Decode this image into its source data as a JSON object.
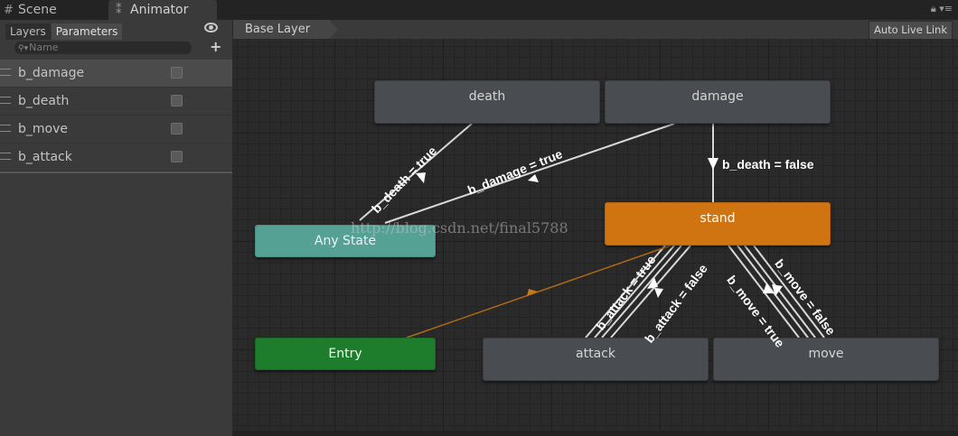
{
  "tabs": [
    {
      "label": "Scene",
      "icon": "grid-icon"
    },
    {
      "label": "Animator",
      "icon": "animator-icon"
    }
  ],
  "window_icons": [
    "lock-icon",
    "menu-icon"
  ],
  "left_panel": {
    "subtabs": [
      "Layers",
      "Parameters"
    ],
    "active_subtab": "Parameters",
    "search_placeholder": "Name",
    "add_label": "+",
    "parameters": [
      {
        "name": "b_damage",
        "type": "bool",
        "checked": false,
        "selected": true
      },
      {
        "name": "b_death",
        "type": "bool",
        "checked": false,
        "selected": false
      },
      {
        "name": "b_move",
        "type": "bool",
        "checked": false,
        "selected": false
      },
      {
        "name": "b_attack",
        "type": "bool",
        "checked": false,
        "selected": false
      }
    ]
  },
  "graph": {
    "breadcrumb": "Base Layer",
    "auto_live_link": "Auto Live Link",
    "states": {
      "death": "death",
      "damage": "damage",
      "any_state": "Any State",
      "stand": "stand",
      "entry": "Entry",
      "attack": "attack",
      "move": "move"
    },
    "transitions": {
      "death": "b_death = true",
      "damage": "b_damage = true",
      "damage_to_stand": "b_death = false",
      "attack_true": "b_attack = true",
      "attack_false": "b_attack = false",
      "move_true": "b_move = true",
      "move_false": "b_move = false"
    },
    "colors": {
      "default_state": "#d07412",
      "any_state": "#55a193",
      "entry": "#1e7d2c",
      "state": "#494c50"
    },
    "watermark": "http://blog.csdn.net/final5788"
  }
}
